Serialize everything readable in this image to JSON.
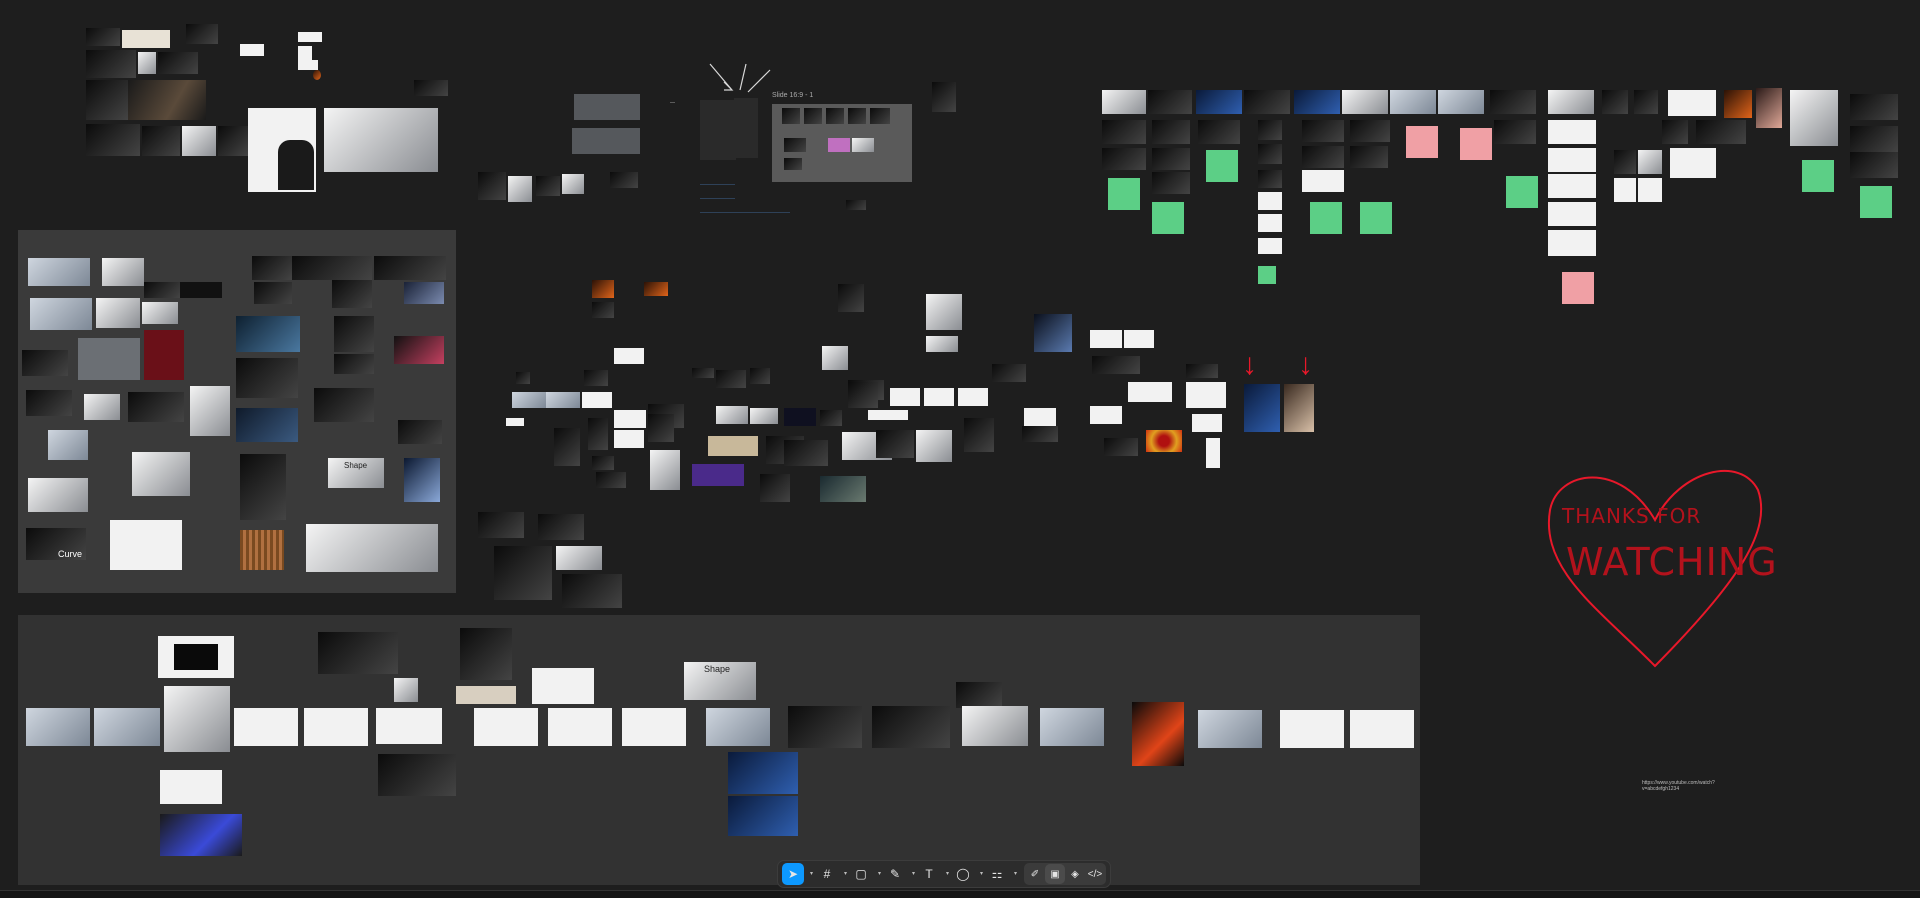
{
  "canvas": {
    "background": "#1e1e1e",
    "section_fill": "#3a3a3a"
  },
  "labels": {
    "slide_title": "Slide 16:9 - 1",
    "curve_label": "Curve",
    "shape_label": "Shape",
    "shape_label_2": "Shape",
    "url_note_line1": "https://www.youtube.com/watch?",
    "url_note_line2": "v=abcdefgh1234"
  },
  "drawing": {
    "heart_line1": "THANKS   FOR",
    "heart_line2": "WATCHING",
    "stroke_color": "#e8182a"
  },
  "toolbar": {
    "tools": [
      {
        "name": "move-tool",
        "icon": "cursor-icon",
        "glyph": "➤",
        "active": true
      },
      {
        "name": "frame-tool",
        "icon": "frame-icon",
        "glyph": "#",
        "active": false
      },
      {
        "name": "shape-tool",
        "icon": "rectangle-icon",
        "glyph": "▢",
        "active": false
      },
      {
        "name": "pen-tool",
        "icon": "pen-icon",
        "glyph": "✎",
        "active": false
      },
      {
        "name": "text-tool",
        "icon": "text-icon",
        "glyph": "T",
        "active": false
      },
      {
        "name": "comment-tool",
        "icon": "comment-icon",
        "glyph": "◯",
        "active": false
      },
      {
        "name": "actions-tool",
        "icon": "actions-icon",
        "glyph": "⚏",
        "active": false
      }
    ],
    "modes": [
      {
        "name": "draw-mode",
        "icon": "draw-icon",
        "glyph": "✐"
      },
      {
        "name": "design-mode",
        "icon": "design-icon",
        "glyph": "▣"
      },
      {
        "name": "prototype-mode",
        "icon": "prototype-icon",
        "glyph": "◈"
      },
      {
        "name": "dev-mode",
        "icon": "code-icon",
        "glyph": "</>"
      }
    ]
  }
}
